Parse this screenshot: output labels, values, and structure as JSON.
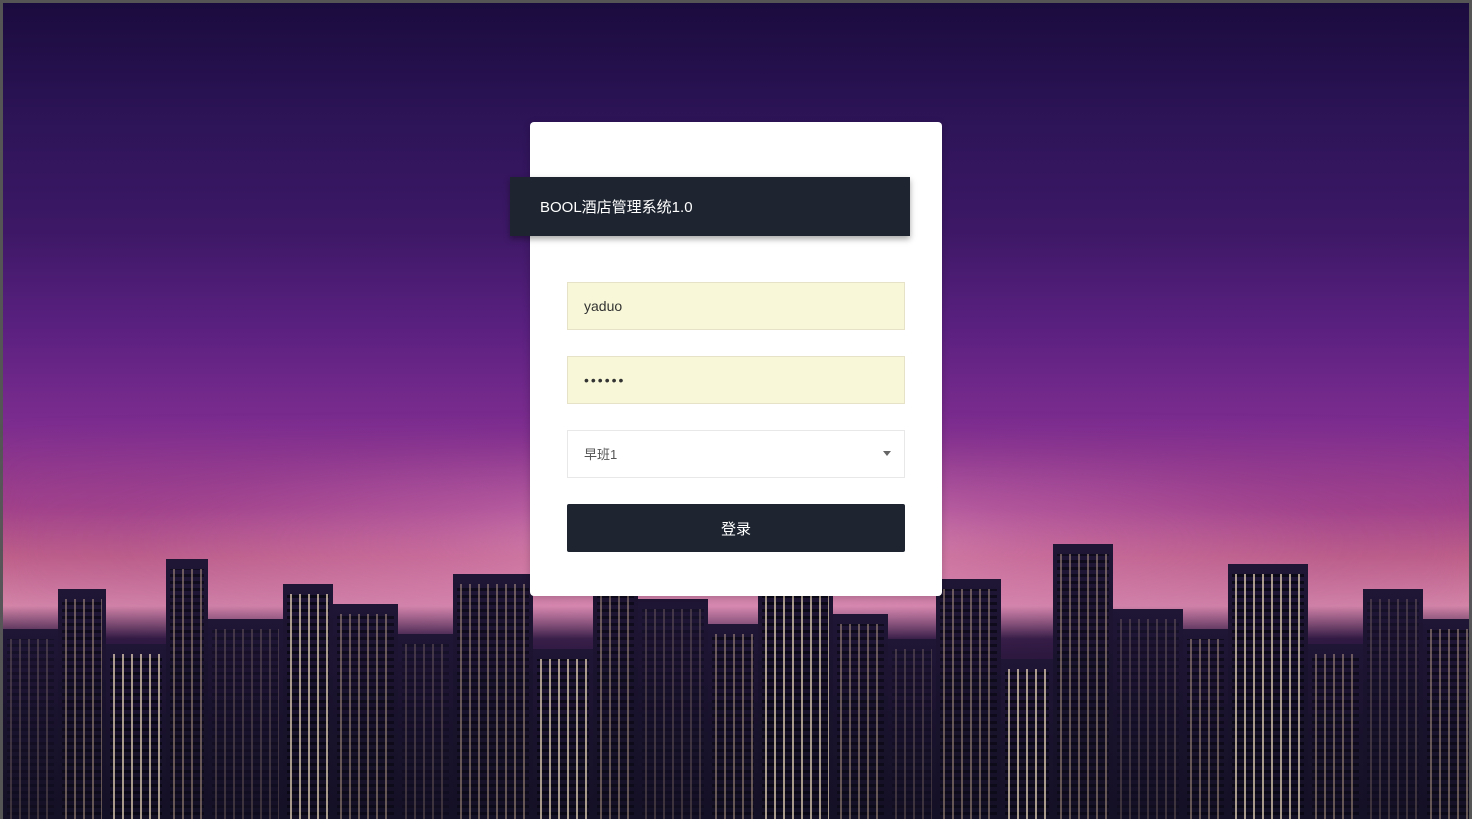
{
  "title": "BOOL酒店管理系统1.0",
  "form": {
    "username_value": "yaduo",
    "password_value": "••••••",
    "shift_selected": "早班1",
    "login_button_label": "登录"
  },
  "colors": {
    "banner_bg": "#1e2530",
    "input_autofill": "#f8f8d8",
    "button_bg": "#1e2530"
  }
}
